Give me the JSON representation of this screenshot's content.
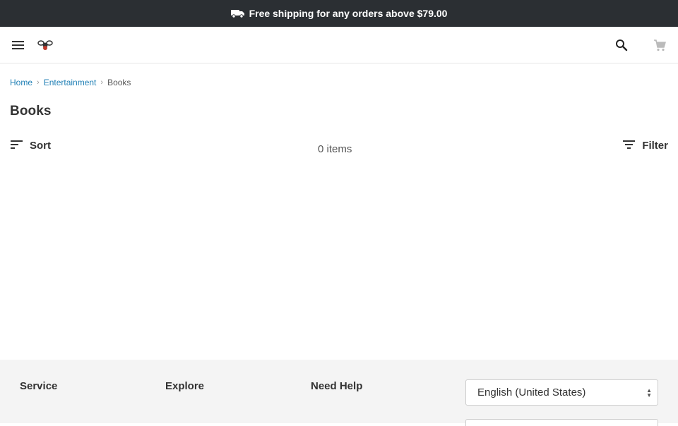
{
  "announcement": {
    "text": "Free shipping for any orders above $79.00",
    "icon": "truck-icon"
  },
  "header": {
    "menu_icon": "menu-icon",
    "logo_icon": "logo-icon",
    "search_icon": "search-icon",
    "cart_icon": "cart-icon"
  },
  "breadcrumb": {
    "items": [
      {
        "label": "Home"
      },
      {
        "label": "Entertainment"
      },
      {
        "label": "Books"
      }
    ]
  },
  "page": {
    "title": "Books"
  },
  "toolbar": {
    "sort_label": "Sort",
    "items_count": "0 items",
    "filter_label": "Filter"
  },
  "footer": {
    "columns": [
      {
        "title": "Service"
      },
      {
        "title": "Explore"
      },
      {
        "title": "Need Help"
      }
    ],
    "language_select": {
      "selected": "English (United States)"
    }
  },
  "colors": {
    "announcement_bg": "#2b2f33",
    "link": "#1f7fb5",
    "footer_bg": "#f4f4f4"
  }
}
